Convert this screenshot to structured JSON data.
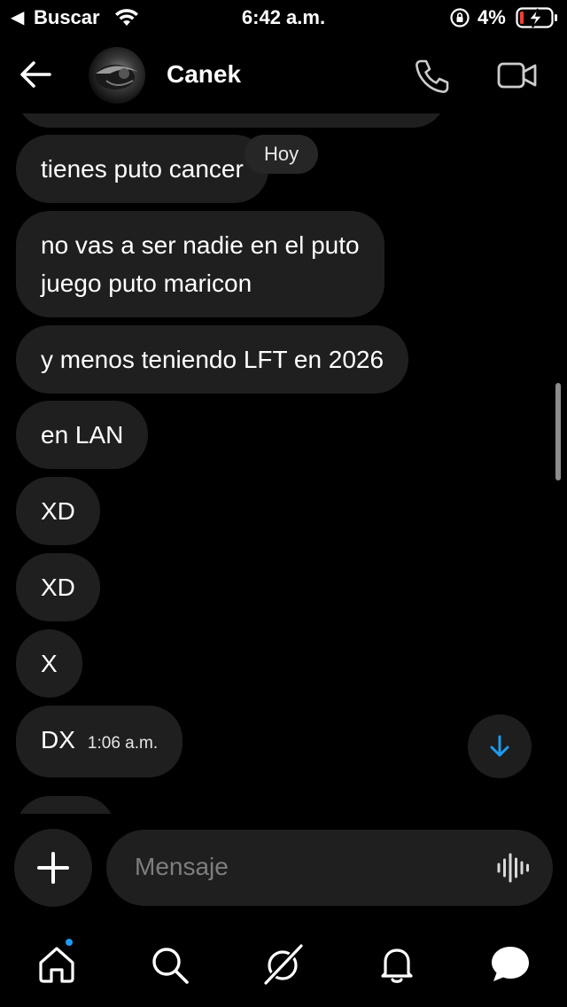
{
  "status_bar": {
    "back_app": "Buscar",
    "time": "6:42 a.m.",
    "battery": "4%"
  },
  "header": {
    "contact_name": "Canek"
  },
  "chat": {
    "date_divider": "Hoy",
    "messages": [
      {
        "text": "tienes puto cancer"
      },
      {
        "text": "no vas a ser nadie en el puto\njuego puto maricon"
      },
      {
        "text": "y menos teniendo LFT en 2026"
      },
      {
        "text": "en LAN"
      },
      {
        "text": "XD"
      },
      {
        "text": "XD"
      },
      {
        "text": "X"
      },
      {
        "text": "DX",
        "time": "1:06 a.m."
      }
    ]
  },
  "composer": {
    "placeholder": "Mensaje"
  },
  "nav": {
    "items": [
      "home",
      "search",
      "grok",
      "notifications",
      "messages"
    ],
    "home_has_badge": true
  },
  "colors": {
    "background": "#000000",
    "bubble": "#1f1f1f",
    "accent": "#1d9bf0",
    "battery_low": "#ff3b30"
  }
}
